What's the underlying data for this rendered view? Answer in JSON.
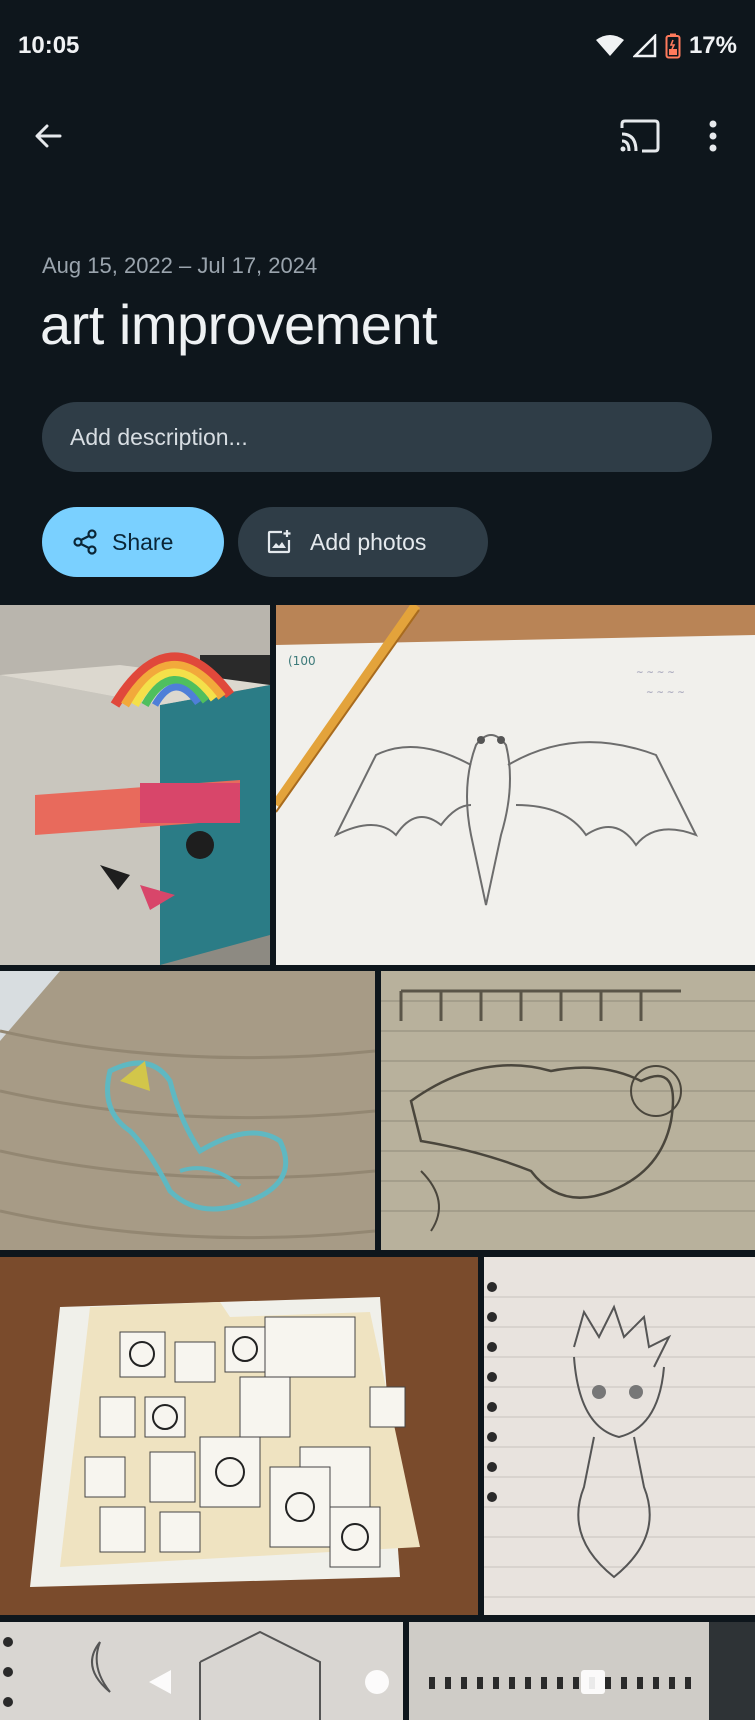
{
  "status_bar": {
    "time": "10:05",
    "battery_percent": "17%",
    "icons": [
      "wifi-icon",
      "cell-signal-icon",
      "battery-low-icon"
    ]
  },
  "app_bar": {
    "icons": [
      "back-arrow-icon",
      "cast-icon",
      "more-vert-icon"
    ]
  },
  "album": {
    "date_range": "Aug 15, 2022 – Jul 17, 2024",
    "title": "art improvement",
    "description_placeholder": "Add description...",
    "share_label": "Share",
    "add_photos_label": "Add photos"
  },
  "photos": [
    "cardboard box with rainbow",
    "bat pencil sketch",
    "desk crayon drawing",
    "notebook character sketch",
    "folder of ink sketches",
    "notebook portrait sketch",
    "notebook moon sketch",
    "spiral notebook"
  ],
  "colors": {
    "background": "#0e161c",
    "accent": "#7ad0ff",
    "surface": "#2f3d47"
  }
}
